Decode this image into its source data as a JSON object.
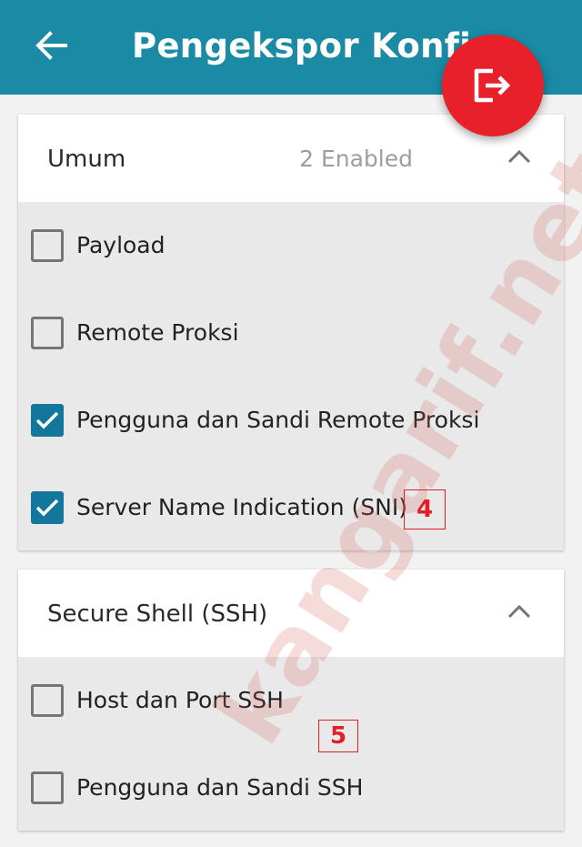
{
  "appbar": {
    "title": "Pengekspor Konfig",
    "back_icon": "arrow-left-icon",
    "color": "#1a8aa5"
  },
  "fab": {
    "icon": "export-icon",
    "color": "#e8202a"
  },
  "sections": [
    {
      "title": "Umum",
      "count": "2 Enabled",
      "expanded": true,
      "options": [
        {
          "label": "Payload",
          "checked": false
        },
        {
          "label": "Remote Proksi",
          "checked": false
        },
        {
          "label": "Pengguna dan Sandi Remote Proksi",
          "checked": true
        },
        {
          "label": "Server Name Indication (SNI)",
          "checked": true
        }
      ]
    },
    {
      "title": "Secure Shell (SSH)",
      "expanded": true,
      "options": [
        {
          "label": "Host dan Port SSH",
          "checked": false
        },
        {
          "label": "Pengguna dan Sandi SSH",
          "checked": false
        }
      ]
    }
  ],
  "annotations": {
    "marker_4": "4",
    "marker_5": "5"
  },
  "watermark": "kangarif.net",
  "colors": {
    "checkbox_checked": "#13779b",
    "annotation": "#e41e26"
  }
}
